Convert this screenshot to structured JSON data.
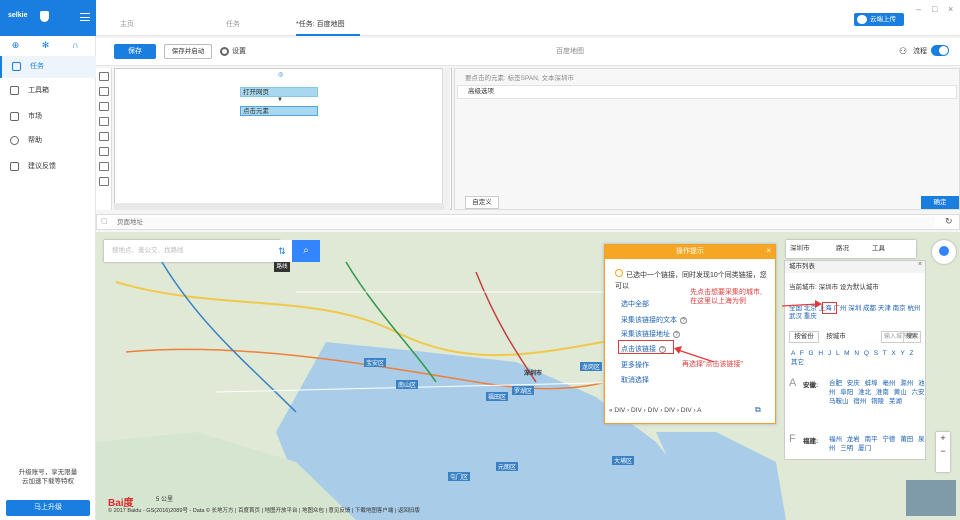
{
  "sidebar": {
    "brand": "selkie",
    "items": [
      {
        "label": "任务"
      },
      {
        "label": "工具箱"
      },
      {
        "label": "市场"
      },
      {
        "label": "帮助"
      },
      {
        "label": "建议反馈"
      }
    ],
    "promo": "升级账号，享无限量\n云加速下载等特权",
    "upgrade": "马上升级"
  },
  "tabs": [
    {
      "label": "主页"
    },
    {
      "label": "任务"
    },
    {
      "label": "*任务: 百度地图"
    }
  ],
  "cloud_upload": "云端上传",
  "toolbar": {
    "save": "保存",
    "save_run": "保存并启动",
    "settings": "设置",
    "page_title": "百度地图",
    "flow": "流程"
  },
  "designer": {
    "nodes": [
      "打开网页",
      "点击元素"
    ]
  },
  "properties": {
    "selected_info": "要点击的元素: 标签SPAN, 文本深圳市",
    "advanced": "高级选项",
    "custom": "自定义",
    "confirm": "确定"
  },
  "url_bar": {
    "placeholder": "页面地址"
  },
  "map": {
    "search_placeholder": "搜地点、查公交、找路线",
    "route_tip": "路线",
    "toolbar": {
      "city": "深圳市",
      "road": "路况",
      "tools": "工具"
    },
    "copyright": "© 2017 Baidu - GS(2016)2089号 - Data © 长地万方 | 百度首页 | 地图开放平台 | 地图众包 | 意见反馈 | 下载地图客户端 | 返回旧版",
    "scale": "5 公里",
    "labels": [
      "宝安区",
      "南山区",
      "福田区",
      "罗湖区",
      "龙岗区",
      "元朗区",
      "大埔区",
      "屯门区",
      "深圳市"
    ]
  },
  "operation_popup": {
    "title": "操作提示",
    "message": "已选中一个链接，同时发现10个同类链接，您可以",
    "options": [
      {
        "label": "选中全部"
      },
      {
        "label": "采集该链接的文本"
      },
      {
        "label": "采集该链接地址"
      },
      {
        "label": "点击该链接"
      },
      {
        "label": "更多操作"
      },
      {
        "label": "取消选择"
      }
    ],
    "path": "« DIV › DIV › DIV › DIV › DIV › A"
  },
  "city_panel": {
    "title": "城市列表",
    "current_city": "当前城市: 深圳市  设为默认城市",
    "hot_cities": "全国 北京 上海 广州 深圳 成都 天津 南京 杭州 武汉 重庆",
    "province_tab": "按省份",
    "city_tab": "按城市",
    "search_placeholder": "输入城市名",
    "search_button": "搜索",
    "letters": "A F G H J L M N Q S T X Y Z 其它",
    "groups": [
      {
        "letter": "A",
        "province": "安徽:",
        "cities": "合肥 安庆 蚌埠 亳州 滁州 池州 阜阳 淮北 淮南 黄山 六安 马鞍山 宿州 铜陵 芜湖"
      },
      {
        "letter": "F",
        "province": "福建:",
        "cities": "福州 龙岩 南平 宁德 莆田 泉州 三明 厦门"
      }
    ]
  },
  "annotations": {
    "city_hint": "先点击想要采集的城市,\n在这里以上海为例",
    "click_hint": "再选择\"点击该链接\""
  },
  "colors": {
    "accent": "#1a7ee0",
    "popup": "#f5a623",
    "annotation": "#e23a3a"
  }
}
